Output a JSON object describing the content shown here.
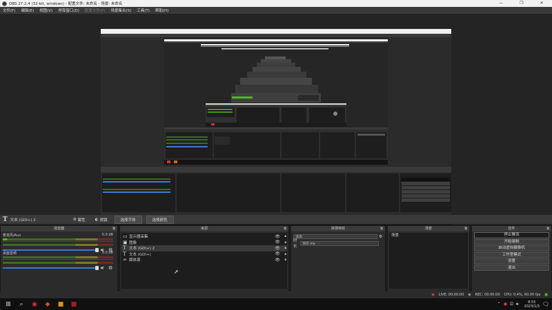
{
  "window": {
    "title": "OBS 27.2.4 (32-bit, windows) - 配置文件: 未命名 - 场景: 未命名",
    "controls": [
      "—",
      "❐",
      "✕"
    ]
  },
  "menu": [
    {
      "label": "文件(F)",
      "disabled": false
    },
    {
      "label": "编辑(E)",
      "disabled": false
    },
    {
      "label": "视图(V)",
      "disabled": false
    },
    {
      "label": "停靠窗口(D)",
      "disabled": false
    },
    {
      "label": "配置文件(P)",
      "disabled": true
    },
    {
      "label": "场景集合(S)",
      "disabled": false
    },
    {
      "label": "工具(T)",
      "disabled": false
    },
    {
      "label": "帮助(H)",
      "disabled": false
    }
  ],
  "source_toolbar": {
    "source_name": "文本 (GDI+) 2",
    "properties": "属性",
    "filters": "滤镜",
    "select_font": "选择字体",
    "select_color": "选择颜色"
  },
  "docks": {
    "mixer": {
      "title": "混音器",
      "channels": [
        {
          "name": "麦克风/Aux",
          "db": "0.0 dB",
          "level": 0.04
        },
        {
          "name": "桌面音频",
          "db": "0.0 dB",
          "level": 0.0
        }
      ]
    },
    "sources": {
      "title": "来源",
      "items": [
        {
          "icon": "display-capture-icon",
          "glyph": "▭",
          "label": "显示器采集",
          "selected": false
        },
        {
          "icon": "image-icon",
          "glyph": "▣",
          "label": "图像",
          "selected": false
        },
        {
          "icon": "text-icon",
          "glyph": "T",
          "label": "文本 (GDI+) 2",
          "selected": true
        },
        {
          "icon": "text-icon",
          "glyph": "T",
          "label": "文本 (GDI+)",
          "selected": false
        },
        {
          "icon": "media-source-icon",
          "glyph": "∞",
          "label": "媒体源",
          "selected": false
        }
      ]
    },
    "transitions": {
      "title": "转场特效",
      "selected": "淡出",
      "duration_label": "时长",
      "duration_value": "300 ms"
    },
    "scenes": {
      "title": "场景",
      "items": [
        "场景"
      ]
    },
    "controls": {
      "title": "控件",
      "buttons": [
        {
          "label": "停止推流",
          "active": true
        },
        {
          "label": "开始录制",
          "active": false
        },
        {
          "label": "启动虚拟摄像机",
          "active": false
        },
        {
          "label": "工作室模式",
          "active": false
        },
        {
          "label": "设置",
          "active": false
        },
        {
          "label": "退出",
          "active": false
        }
      ]
    }
  },
  "status": {
    "live": "LIVE: 00:00:00",
    "rec": "REC: 00:00:00",
    "cpu": "CPU: 0.4%, 60.00 fps"
  },
  "taskbar": {
    "time": "8:55",
    "date": "2023/1/3"
  },
  "colors": {
    "meter_green": "#4cbb17",
    "slider_blue": "#3b7bd4",
    "live_red": "#d33",
    "background": "#1e1e1e"
  }
}
